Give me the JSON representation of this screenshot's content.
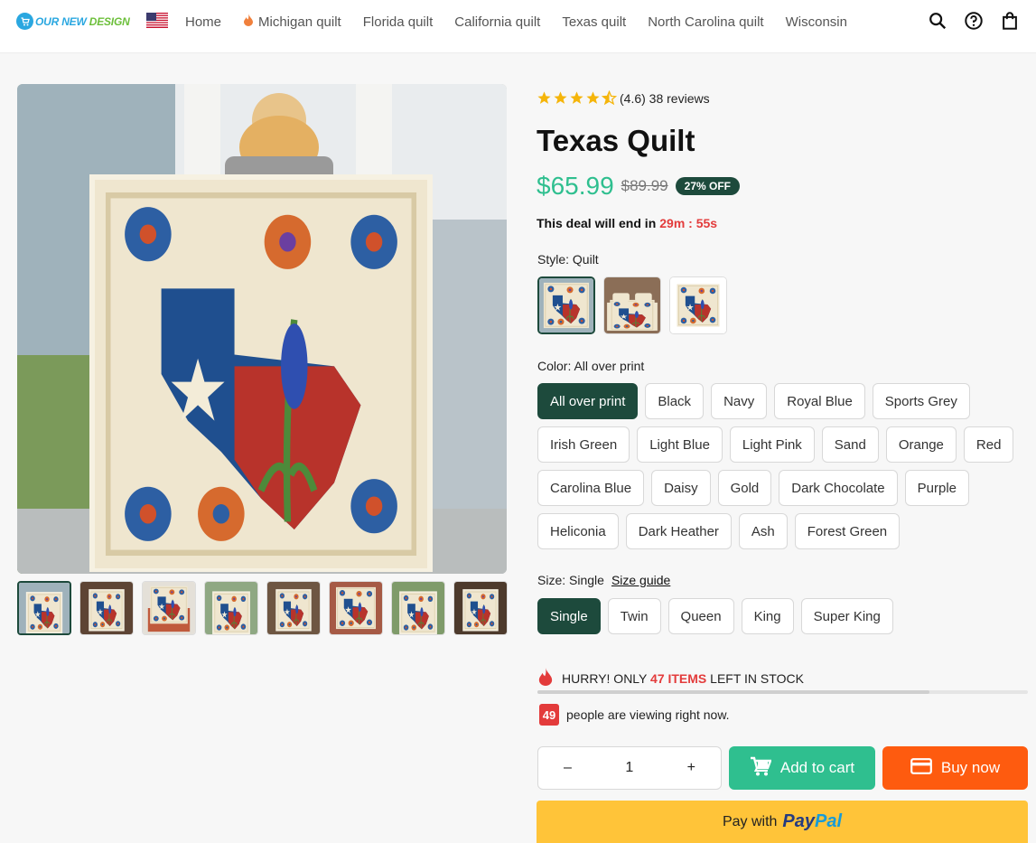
{
  "header": {
    "logo": {
      "part1": "OUR NEW ",
      "part2": "DESIGN"
    },
    "nav": [
      {
        "label": "Home",
        "fire": false
      },
      {
        "label": "Michigan quilt",
        "fire": true
      },
      {
        "label": "Florida quilt",
        "fire": false
      },
      {
        "label": "California quilt",
        "fire": false
      },
      {
        "label": "Texas quilt",
        "fire": false
      },
      {
        "label": "North Carolina quilt",
        "fire": false
      },
      {
        "label": "Wisconsin",
        "fire": false
      }
    ]
  },
  "product": {
    "rating_value": 4.6,
    "rating_text": "(4.6) 38 reviews",
    "title": "Texas Quilt",
    "price": "$65.99",
    "old_price": "$89.99",
    "discount": "27% OFF",
    "deal_text": "This deal will end in",
    "deal_timer": "29m : 55s",
    "style_label": "Style: Quilt",
    "color_label": "Color: All over print",
    "colors": [
      "All over print",
      "Black",
      "Navy",
      "Royal Blue",
      "Sports Grey",
      "Irish Green",
      "Light Blue",
      "Light Pink",
      "Sand",
      "Orange",
      "Red",
      "Carolina Blue",
      "Daisy",
      "Gold",
      "Dark Chocolate",
      "Purple",
      "Heliconia",
      "Dark Heather",
      "Ash",
      "Forest Green"
    ],
    "selected_color": "All over print",
    "size_label": "Size: Single",
    "size_guide": "Size guide",
    "sizes": [
      "Single",
      "Twin",
      "Queen",
      "King",
      "Super King"
    ],
    "selected_size": "Single",
    "stock_prefix": "HURRY! ONLY",
    "stock_count": "47 ITEMS",
    "stock_suffix": "LEFT IN STOCK",
    "stock_level": 0.8,
    "viewers": "49",
    "viewers_text": "people are viewing right now.",
    "quantity": "1",
    "minus": "–",
    "plus": "+",
    "add_to_cart": "Add to cart",
    "buy_now": "Buy now",
    "pay_with": "Pay with",
    "paypal1": "Pay",
    "paypal2": "Pal"
  },
  "colors": {
    "accent_green": "#2fbf8f",
    "dark_green": "#1d4a3c",
    "orange": "#fe5b0f",
    "paypal_yellow": "#ffc439",
    "alert_red": "#e33b3b"
  }
}
